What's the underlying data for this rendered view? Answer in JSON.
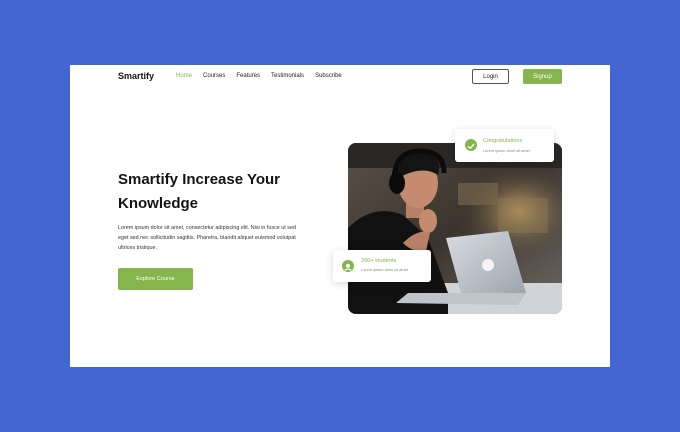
{
  "brand": {
    "logo": "Smartify"
  },
  "nav": {
    "items": [
      "Home",
      "Courses",
      "Features",
      "Testimonials",
      "Subscribe"
    ],
    "active": "Home",
    "login_label": "Login",
    "signup_label": "Signup"
  },
  "hero": {
    "title": "Smartify Increase Your Knowledge",
    "description": "Lorem ipsum dolor sit amet, consectetur adipiscing elit. Nisi in fusce ut sed eget sed nec sollicitudin sagittis. Pharetra, blandit aliquet euismod volutpat ultrices tristique.",
    "cta_label": "Explore Course"
  },
  "cards": {
    "congrats": {
      "title": "Congratulations",
      "subtitle": "Lorem ipsum dolor sit amet"
    },
    "students": {
      "title": "200+ students",
      "subtitle": "Lorem ipsum dolor sit amet"
    }
  },
  "colors": {
    "background": "#4466d2",
    "accent": "#86b54e",
    "text_dark": "#141414"
  },
  "icons": {
    "congrats": "check-circle-icon",
    "students": "user-circle-icon"
  }
}
